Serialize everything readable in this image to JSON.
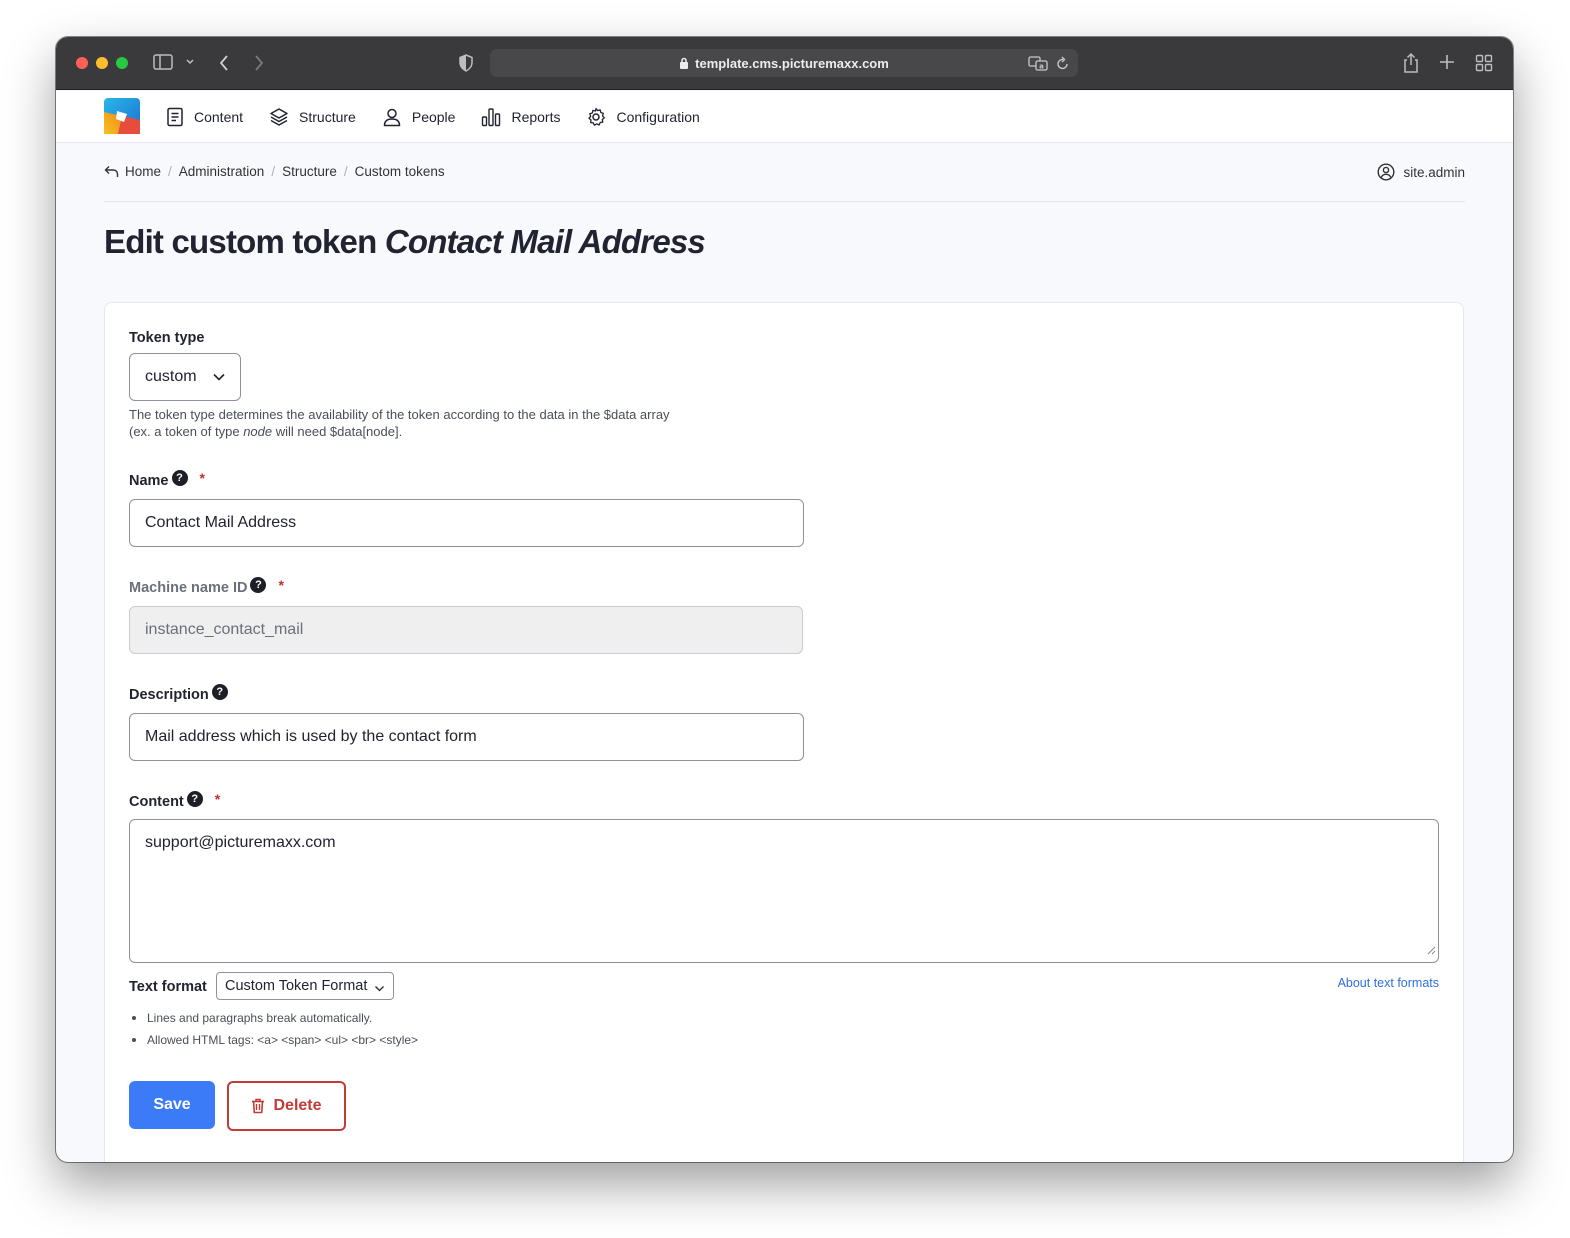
{
  "browser": {
    "url": "template.cms.picturemaxx.com"
  },
  "nav": {
    "items": [
      {
        "label": "Content",
        "icon": "document-icon"
      },
      {
        "label": "Structure",
        "icon": "layers-icon"
      },
      {
        "label": "People",
        "icon": "person-icon"
      },
      {
        "label": "Reports",
        "icon": "bar-chart-icon"
      },
      {
        "label": "Configuration",
        "icon": "gear-icon"
      }
    ]
  },
  "breadcrumb": {
    "items": [
      "Home",
      "Administration",
      "Structure",
      "Custom tokens"
    ]
  },
  "user": {
    "name": "site.admin"
  },
  "page": {
    "title_prefix": "Edit custom token",
    "title_name": "Contact Mail Address"
  },
  "form": {
    "token_type": {
      "label": "Token type",
      "value": "custom",
      "description_part1": "The token type determines the availability of the token according to the data in the $data array (ex. a token of type ",
      "description_em": "node",
      "description_part2": " will need $data[node]."
    },
    "name": {
      "label": "Name",
      "help": "?",
      "required": "*",
      "value": "Contact Mail Address"
    },
    "machine_name": {
      "label": "Machine name ID",
      "help": "?",
      "required": "*",
      "value": "instance_contact_mail"
    },
    "description": {
      "label": "Description",
      "help": "?",
      "value": "Mail address which is used by the contact form"
    },
    "content": {
      "label": "Content",
      "help": "?",
      "required": "*",
      "value": "support@picturemaxx.com"
    },
    "text_format": {
      "label": "Text format",
      "value": "Custom Token Format",
      "about_link": "About text formats",
      "tips": [
        "Lines and paragraphs break automatically.",
        "Allowed HTML tags: <a> <span> <ul> <br> <style>"
      ]
    },
    "actions": {
      "save_label": "Save",
      "delete_label": "Delete"
    }
  },
  "colors": {
    "primary": "#3b7bf7",
    "danger": "#c23b36",
    "link": "#2f6fe0"
  }
}
